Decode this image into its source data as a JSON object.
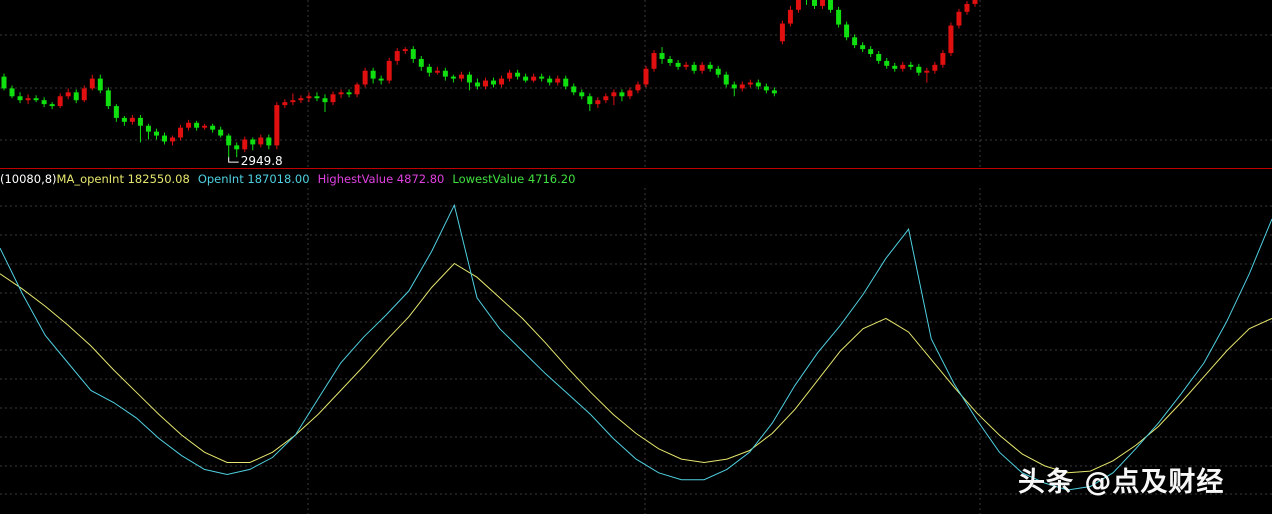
{
  "colors": {
    "background": "#000000",
    "up_candle": "#e01010",
    "down_candle": "#10e010",
    "grid": "#3a3a3a",
    "divider": "#c00000",
    "ma_line": "#e6e66e",
    "openint_line": "#4fd0e0",
    "params_text": "#ffffff",
    "ma_text": "#e6e66e",
    "openint_text": "#4fd0e0",
    "highest_text": "#e040e0",
    "lowest_text": "#40e040"
  },
  "legend": {
    "params": "(10080,8)",
    "ma": "MA_openInt 182550.08",
    "openint": "OpenInt 187018.00",
    "highest": "HighestValue 4872.80",
    "lowest": "LowestValue 4716.20"
  },
  "price_panel": {
    "low_marker": "2949.8"
  },
  "watermark": "头条 @点及财经",
  "chart_data": [
    {
      "type": "candlestick",
      "title": "",
      "xlabel": "",
      "ylabel": "",
      "annotations": [
        "2949.8"
      ],
      "ylim": [
        2940,
        3110
      ],
      "candles": [
        [
          3032,
          3020,
          3035,
          3018
        ],
        [
          3020,
          3012,
          3023,
          3010
        ],
        [
          3012,
          3008,
          3016,
          3005
        ],
        [
          3008,
          3010,
          3014,
          3004
        ],
        [
          3010,
          3008,
          3013,
          3006
        ],
        [
          3008,
          3004,
          3011,
          3001
        ],
        [
          3004,
          3002,
          3006,
          2999
        ],
        [
          3002,
          3012,
          3015,
          3000
        ],
        [
          3012,
          3016,
          3020,
          3009
        ],
        [
          3016,
          3008,
          3019,
          3005
        ],
        [
          3008,
          3020,
          3023,
          3006
        ],
        [
          3020,
          3030,
          3034,
          3018
        ],
        [
          3030,
          3018,
          3034,
          3015
        ],
        [
          3018,
          3002,
          3021,
          2999
        ],
        [
          3002,
          2990,
          3004,
          2986
        ],
        [
          2990,
          2986,
          2992,
          2982
        ],
        [
          2986,
          2990,
          2993,
          2983
        ],
        [
          2990,
          2982,
          2993,
          2965
        ],
        [
          2982,
          2976,
          2984,
          2968
        ],
        [
          2976,
          2972,
          2979,
          2968
        ],
        [
          2972,
          2966,
          2975,
          2963
        ],
        [
          2966,
          2970,
          2972,
          2962
        ],
        [
          2970,
          2980,
          2983,
          2967
        ],
        [
          2980,
          2985,
          2988,
          2977
        ],
        [
          2985,
          2980,
          2987,
          2977
        ],
        [
          2980,
          2982,
          2984,
          2978
        ],
        [
          2982,
          2978,
          2984,
          2975
        ],
        [
          2978,
          2972,
          2981,
          2970
        ],
        [
          2972,
          2962,
          2974,
          2950
        ],
        [
          2962,
          2958,
          2965,
          2950
        ],
        [
          2958,
          2968,
          2971,
          2955
        ],
        [
          2968,
          2963,
          2970,
          2957
        ],
        [
          2963,
          2970,
          2973,
          2960
        ],
        [
          2970,
          2962,
          2973,
          2958
        ],
        [
          2962,
          3003,
          3006,
          2958
        ],
        [
          3003,
          3006,
          3009,
          3000
        ],
        [
          3006,
          3008,
          3015,
          3003
        ],
        [
          3008,
          3010,
          3013,
          3005
        ],
        [
          3010,
          3012,
          3016,
          3006
        ],
        [
          3012,
          3010,
          3016,
          3007
        ],
        [
          3010,
          3006,
          3014,
          2996
        ],
        [
          3006,
          3014,
          3017,
          3003
        ],
        [
          3014,
          3016,
          3019,
          3010
        ],
        [
          3016,
          3014,
          3019,
          3011
        ],
        [
          3014,
          3024,
          3026,
          3011
        ],
        [
          3024,
          3038,
          3041,
          3021
        ],
        [
          3038,
          3030,
          3041,
          3025
        ],
        [
          3030,
          3028,
          3033,
          3024
        ],
        [
          3028,
          3048,
          3051,
          3025
        ],
        [
          3048,
          3058,
          3061,
          3044
        ],
        [
          3058,
          3060,
          3062,
          3055
        ],
        [
          3060,
          3050,
          3063,
          3046
        ],
        [
          3050,
          3042,
          3053,
          3038
        ],
        [
          3042,
          3036,
          3045,
          3032
        ],
        [
          3036,
          3038,
          3042,
          3034
        ],
        [
          3038,
          3032,
          3041,
          3028
        ],
        [
          3032,
          3030,
          3034,
          3026
        ],
        [
          3030,
          3034,
          3037,
          3027
        ],
        [
          3034,
          3026,
          3037,
          3018
        ],
        [
          3026,
          3022,
          3030,
          3019
        ],
        [
          3022,
          3028,
          3031,
          3019
        ],
        [
          3028,
          3024,
          3031,
          3021
        ],
        [
          3024,
          3030,
          3033,
          3021
        ],
        [
          3030,
          3036,
          3039,
          3027
        ],
        [
          3036,
          3032,
          3039,
          3029
        ],
        [
          3032,
          3028,
          3035,
          3026
        ],
        [
          3028,
          3032,
          3035,
          3026
        ],
        [
          3032,
          3030,
          3035,
          3027
        ],
        [
          3030,
          3026,
          3033,
          3023
        ],
        [
          3026,
          3030,
          3033,
          3023
        ],
        [
          3030,
          3022,
          3033,
          3019
        ],
        [
          3022,
          3016,
          3025,
          3013
        ],
        [
          3016,
          3012,
          3019,
          3009
        ],
        [
          3012,
          3004,
          3015,
          2997
        ],
        [
          3004,
          3008,
          3011,
          3000
        ],
        [
          3008,
          3012,
          3015,
          3005
        ],
        [
          3012,
          3016,
          3019,
          3003
        ],
        [
          3016,
          3012,
          3019,
          3007
        ],
        [
          3012,
          3018,
          3021,
          3009
        ],
        [
          3018,
          3024,
          3027,
          3015
        ],
        [
          3024,
          3040,
          3043,
          3021
        ],
        [
          3040,
          3056,
          3059,
          3037
        ],
        [
          3056,
          3050,
          3062,
          3045
        ],
        [
          3050,
          3046,
          3053,
          3043
        ],
        [
          3046,
          3042,
          3049,
          3039
        ],
        [
          3042,
          3044,
          3047,
          3039
        ],
        [
          3044,
          3038,
          3047,
          3035
        ],
        [
          3038,
          3044,
          3047,
          3035
        ],
        [
          3044,
          3040,
          3047,
          3037
        ],
        [
          3040,
          3034,
          3043,
          3031
        ],
        [
          3034,
          3024,
          3037,
          3021
        ],
        [
          3024,
          3020,
          3027,
          3012
        ],
        [
          3020,
          3024,
          3027,
          3017
        ],
        [
          3024,
          3026,
          3029,
          3021
        ],
        [
          3026,
          3022,
          3029,
          3019
        ],
        [
          3022,
          3018,
          3025,
          3015
        ],
        [
          3018,
          3015,
          3021,
          3012
        ],
        [
          3068,
          3086,
          3089,
          3065
        ],
        [
          3086,
          3100,
          3104,
          3083
        ],
        [
          3100,
          3115,
          3118,
          3097
        ],
        [
          3115,
          3110,
          3118,
          3105
        ],
        [
          3110,
          3104,
          3113,
          3101
        ],
        [
          3104,
          3110,
          3113,
          3101
        ],
        [
          3110,
          3100,
          3113,
          3097
        ],
        [
          3100,
          3085,
          3103,
          3082
        ],
        [
          3085,
          3072,
          3088,
          3069
        ],
        [
          3072,
          3064,
          3075,
          3061
        ],
        [
          3064,
          3060,
          3067,
          3057
        ],
        [
          3060,
          3055,
          3063,
          3052
        ],
        [
          3055,
          3048,
          3058,
          3045
        ],
        [
          3048,
          3043,
          3051,
          3040
        ],
        [
          3043,
          3040,
          3046,
          3037
        ],
        [
          3040,
          3044,
          3047,
          3037
        ],
        [
          3044,
          3042,
          3047,
          3039
        ],
        [
          3042,
          3036,
          3045,
          3033
        ],
        [
          3036,
          3038,
          3041,
          3026
        ],
        [
          3038,
          3044,
          3047,
          3035
        ],
        [
          3044,
          3056,
          3059,
          3041
        ],
        [
          3056,
          3084,
          3087,
          3053
        ],
        [
          3084,
          3098,
          3101,
          3081
        ],
        [
          3098,
          3106,
          3109,
          3095
        ],
        [
          3106,
          3116,
          3119,
          3103
        ]
      ]
    },
    {
      "type": "line",
      "title": "",
      "xlabel": "",
      "ylabel": "",
      "series": [
        {
          "name": "MA_openInt",
          "color": "#e6e66e",
          "values": [
            200,
            191,
            181,
            170,
            158,
            144,
            131,
            118,
            106,
            96,
            90,
            90,
            96,
            106,
            118,
            132,
            146,
            161,
            175,
            192,
            206,
            198,
            186,
            174,
            160,
            145,
            131,
            118,
            107,
            98,
            92,
            90,
            92,
            97,
            107,
            121,
            138,
            155,
            168,
            174,
            166,
            150,
            134,
            119,
            106,
            95,
            88,
            84,
            85,
            91,
            100,
            111,
            125,
            140,
            155,
            168,
            174
          ]
        },
        {
          "name": "OpenInt",
          "color": "#4fd0e0",
          "values": [
            215,
            188,
            164,
            148,
            132,
            125,
            116,
            104,
            94,
            86,
            83,
            86,
            93,
            106,
            127,
            148,
            163,
            176,
            190,
            213,
            240,
            186,
            168,
            155,
            142,
            130,
            118,
            104,
            92,
            84,
            80,
            80,
            86,
            96,
            113,
            135,
            154,
            170,
            188,
            209,
            226,
            162,
            136,
            115,
            96,
            84,
            78,
            74,
            76,
            84,
            98,
            113,
            130,
            148,
            172,
            200,
            232
          ]
        }
      ]
    }
  ]
}
